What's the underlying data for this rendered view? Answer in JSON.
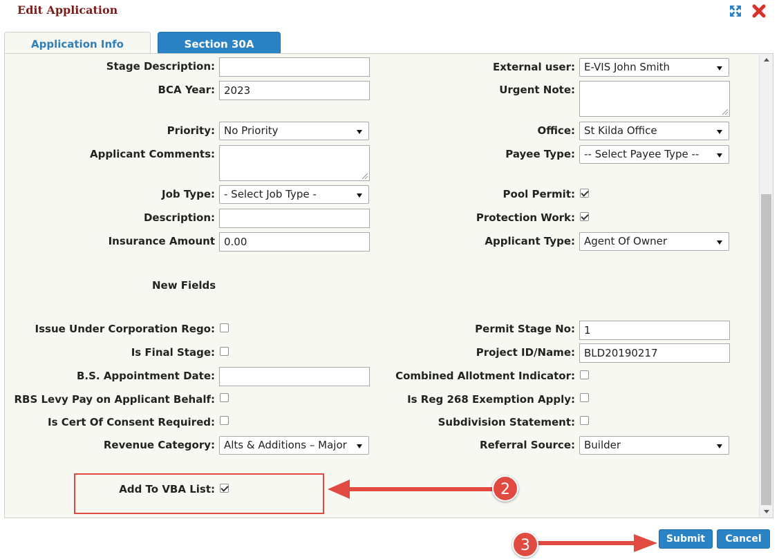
{
  "dialog": {
    "title": "Edit Application"
  },
  "tabs": [
    {
      "label": "Application Info",
      "active": true
    },
    {
      "label": "Section 30A",
      "active": false
    }
  ],
  "left_fields": {
    "stage_description": {
      "label": "Stage Description:",
      "value": ""
    },
    "bca_year": {
      "label": "BCA Year:",
      "value": "2023"
    },
    "priority": {
      "label": "Priority:",
      "value": "No Priority"
    },
    "applicant_comments": {
      "label": "Applicant Comments:",
      "value": ""
    },
    "job_type": {
      "label": "Job Type:",
      "value": "- Select Job Type -"
    },
    "description": {
      "label": "Description:",
      "value": ""
    },
    "insurance_amount": {
      "label": "Insurance Amount",
      "value": "0.00"
    }
  },
  "right_fields": {
    "external_user": {
      "label": "External user:",
      "value": "E-VIS John Smith"
    },
    "urgent_note": {
      "label": "Urgent Note:",
      "value": ""
    },
    "office": {
      "label": "Office:",
      "value": "St Kilda Office"
    },
    "payee_type": {
      "label": "Payee Type:",
      "value": "-- Select Payee Type --"
    },
    "pool_permit": {
      "label": "Pool Permit:",
      "checked": true
    },
    "protection_work": {
      "label": "Protection Work:",
      "checked": true
    },
    "applicant_type": {
      "label": "Applicant Type:",
      "value": "Agent Of Owner"
    }
  },
  "new_fields": {
    "heading": "New Fields",
    "issue_under_corp_rego": {
      "label": "Issue Under Corporation Rego:",
      "checked": false
    },
    "is_final_stage": {
      "label": "Is Final Stage:",
      "checked": false
    },
    "bs_appointment_date": {
      "label": "B.S. Appointment Date:",
      "value": ""
    },
    "rbs_levy": {
      "label": "RBS Levy Pay on Applicant Behalf:",
      "checked": false
    },
    "cert_of_consent": {
      "label": "Is Cert Of Consent Required:",
      "checked": false
    },
    "revenue_category": {
      "label": "Revenue Category:",
      "value": "Alts & Additions – Major"
    },
    "add_to_vba": {
      "label": "Add To VBA List:",
      "checked": true
    },
    "permit_stage_no": {
      "label": "Permit Stage No:",
      "value": "1"
    },
    "project_id": {
      "label": "Project ID/Name:",
      "value": "BLD20190217"
    },
    "combined_allotment": {
      "label": "Combined Allotment Indicator:",
      "checked": false
    },
    "reg_268": {
      "label": "Is Reg 268 Exemption Apply:",
      "checked": false
    },
    "subdivision_statement": {
      "label": "Subdivision Statement:",
      "checked": false
    },
    "referral_source": {
      "label": "Referral Source:",
      "value": "Builder"
    }
  },
  "annotations": {
    "badge_2": "2",
    "badge_3": "3"
  },
  "buttons": {
    "submit": "Submit",
    "cancel": "Cancel"
  },
  "colors": {
    "title": "#7a1c1c",
    "accent": "#2a83c5",
    "annotation": "#e04a40"
  }
}
